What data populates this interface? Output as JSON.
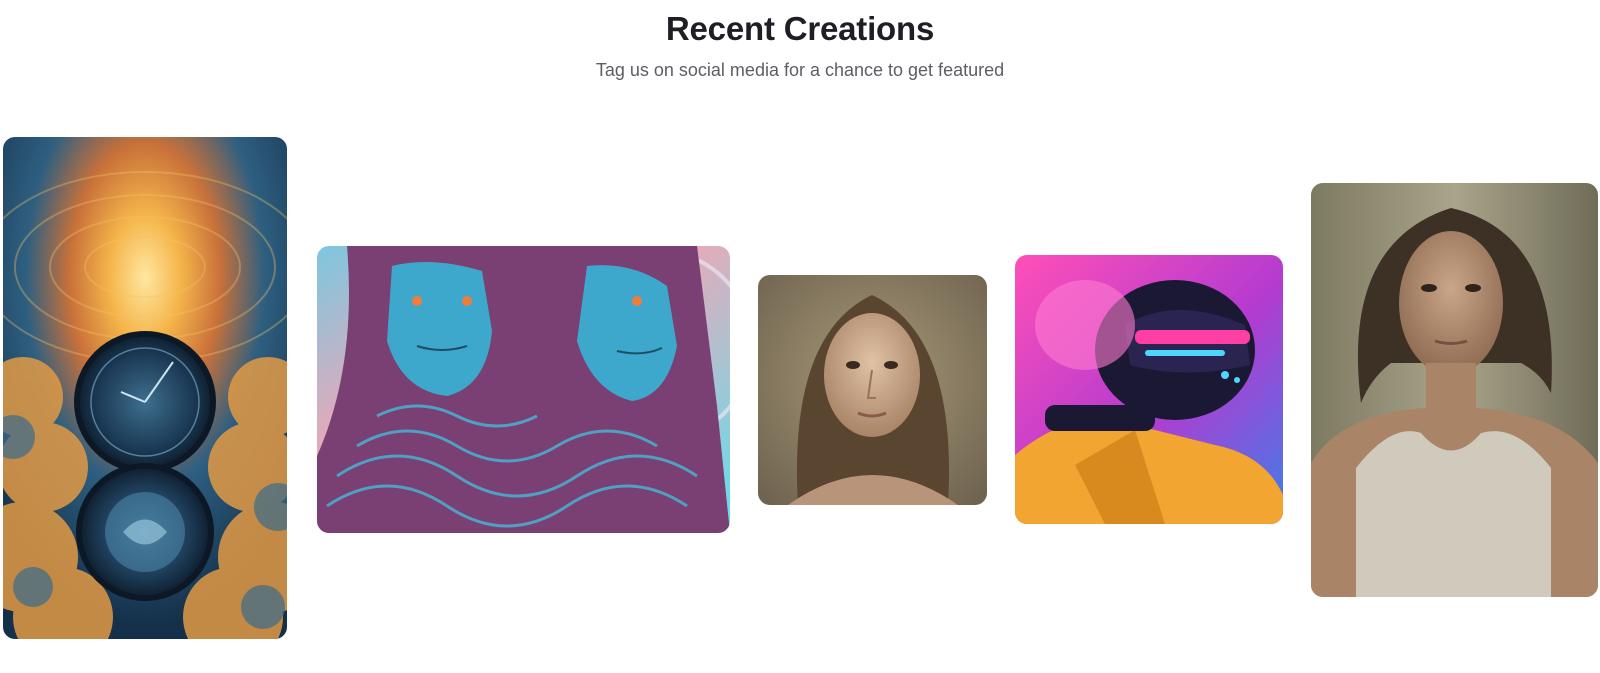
{
  "section": {
    "title": "Recent Creations",
    "subtitle": "Tag us on social media for a chance to get featured"
  },
  "gallery": {
    "items": [
      {
        "alt": "Surreal hourglass of clocks in golden clouds",
        "palette": [
          "#1b3a5c",
          "#f2a93b",
          "#2d6c8e"
        ]
      },
      {
        "alt": "Two blue-faced figures in swirling purple robes",
        "palette": [
          "#38b6d4",
          "#7a3f73",
          "#f5b7a3"
        ]
      },
      {
        "alt": "Portrait of a freckled woman with brown hair",
        "palette": [
          "#8a7a62",
          "#5a4630",
          "#c9a98a"
        ]
      },
      {
        "alt": "Astronaut in yellow suit with neon helmet",
        "palette": [
          "#d43fa8",
          "#f2a531",
          "#1b1833"
        ]
      },
      {
        "alt": "Painted portrait of a woman in a white tank top",
        "palette": [
          "#8c8a74",
          "#3d3024",
          "#c9c2b0"
        ]
      }
    ]
  }
}
